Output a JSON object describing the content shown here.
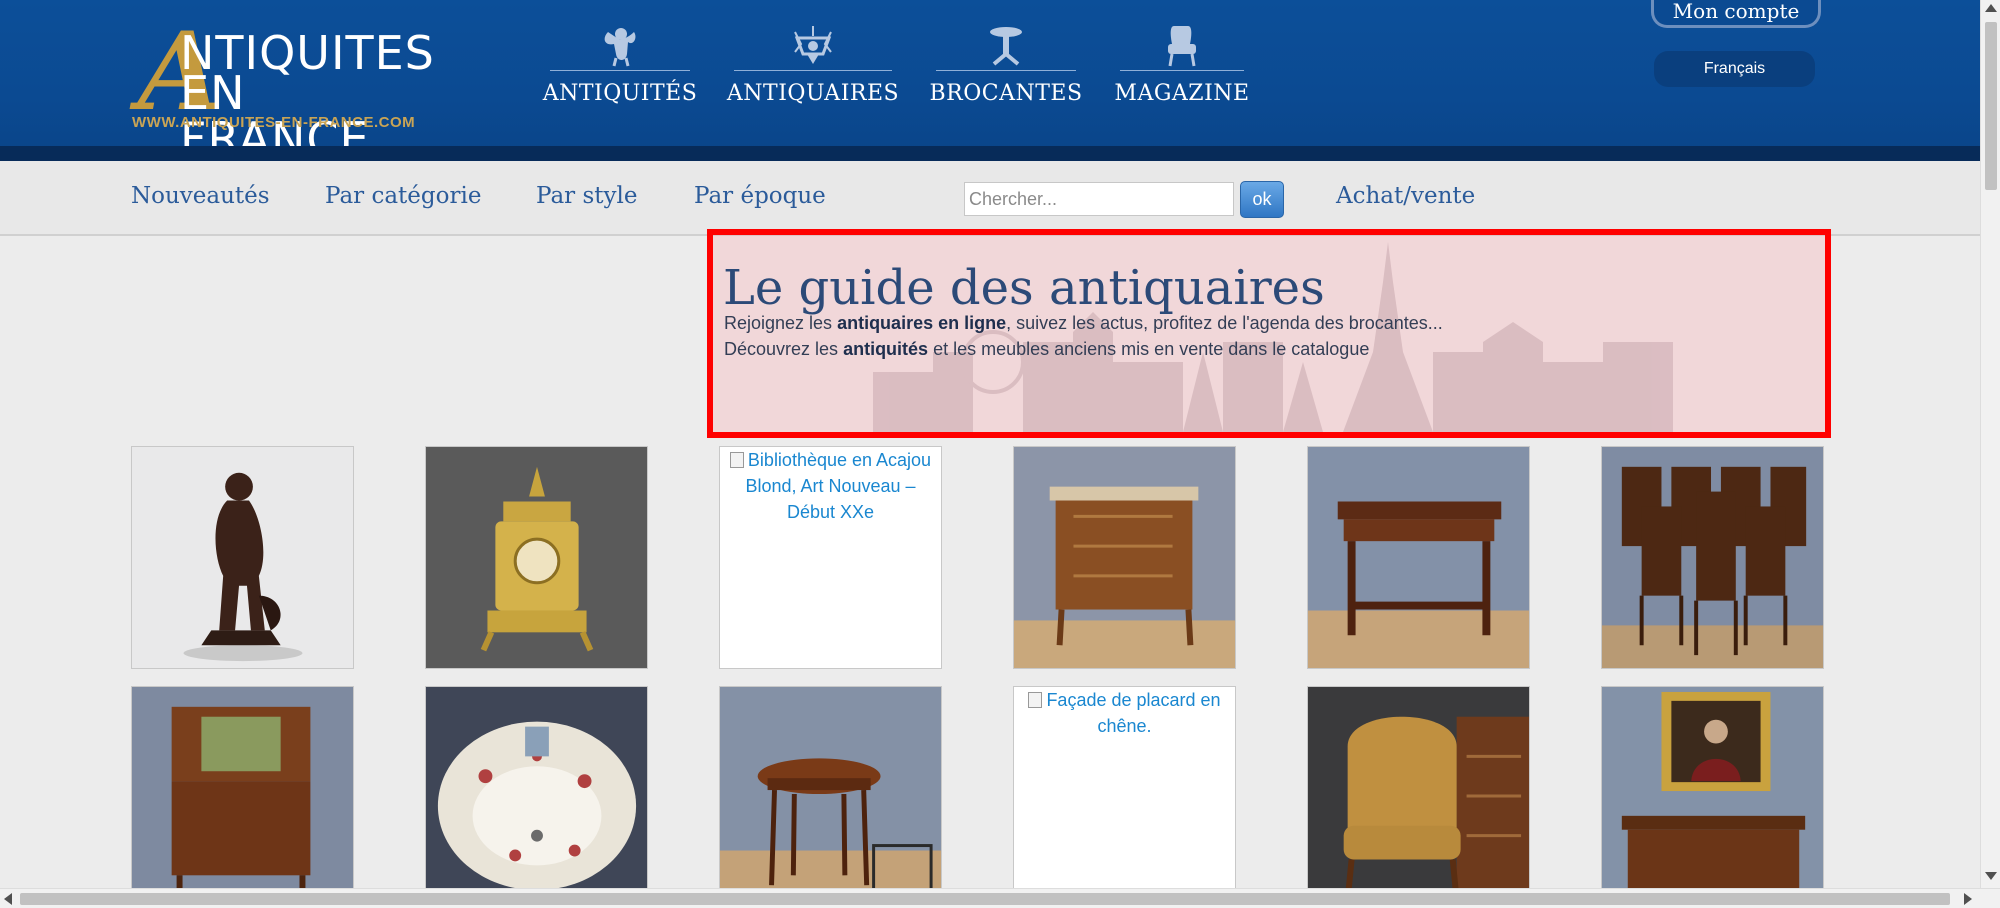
{
  "header": {
    "logo": {
      "line1": "NTIQUITES",
      "line2": "EN FRANCE",
      "big_letter": "A",
      "url": "WWW.ANTIQUITES-EN-FRANCE.COM"
    },
    "nav": [
      {
        "label": "ANTIQUITÉS",
        "icon": "cherub-icon"
      },
      {
        "label": "ANTIQUAIRES",
        "icon": "chandelier-icon"
      },
      {
        "label": "BROCANTES",
        "icon": "pedestal-table-icon"
      },
      {
        "label": "MAGAZINE",
        "icon": "armchair-icon"
      }
    ],
    "account_label": "Mon compte",
    "language_label": "Français"
  },
  "subnav": {
    "links": [
      "Nouveautés",
      "Par catégorie",
      "Par style",
      "Par époque"
    ],
    "search_placeholder": "Chercher...",
    "search_button": "ok",
    "buy_sell": "Achat/vente"
  },
  "guide": {
    "title": "Le guide des antiquaires",
    "line1_pre": "Rejoignez les ",
    "line1_bold": "antiquaires en ligne",
    "line1_post": ", suivez les actus, profitez de l'agenda des brocantes...",
    "line2_pre": "Découvrez les ",
    "line2_bold": "antiquités",
    "line2_post": " et les meubles anciens mis en vente dans le catalogue"
  },
  "products": [
    {
      "kind": "bronze-statue",
      "alt": ""
    },
    {
      "kind": "gilt-clock",
      "alt": ""
    },
    {
      "kind": "broken",
      "alt": "Bibliothèque en Acajou Blond, Art Nouveau – Début XXe"
    },
    {
      "kind": "marquetry-commode",
      "alt": ""
    },
    {
      "kind": "writing-table",
      "alt": ""
    },
    {
      "kind": "dining-chairs",
      "alt": ""
    },
    {
      "kind": "washstand",
      "alt": ""
    },
    {
      "kind": "faience-basin",
      "alt": ""
    },
    {
      "kind": "oval-side-table",
      "alt": ""
    },
    {
      "kind": "broken",
      "alt": "Façade de placard en chêne."
    },
    {
      "kind": "leather-armchair",
      "alt": ""
    },
    {
      "kind": "portrait-desk",
      "alt": ""
    }
  ],
  "colors": {
    "header_blue": "#0b4a92",
    "header_dark_strip": "#072b59",
    "logo_gold": "#c49a3e",
    "link_blue": "#2b5b9a",
    "highlight_red": "#ff0000"
  }
}
